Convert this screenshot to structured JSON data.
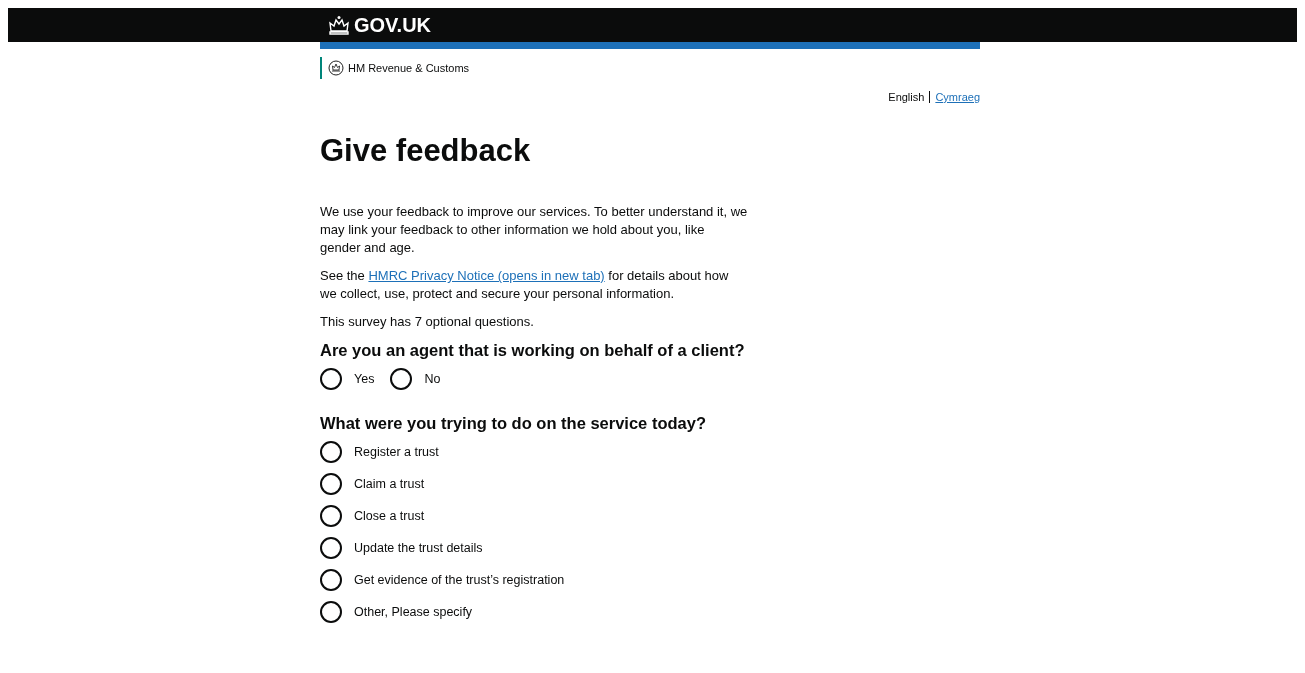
{
  "header": {
    "logo": "GOV.UK"
  },
  "organisation": "HM Revenue & Customs",
  "languages": [
    {
      "label": "English",
      "selected": true
    },
    {
      "label": "Cymraeg",
      "selected": false
    }
  ],
  "title": "Give feedback",
  "intro": "We use your feedback to improve our services. To better understand it, we may link your feedback to other information we hold about you, like gender and age.",
  "privacy": {
    "before": "See the ",
    "link": "HMRC Privacy Notice (opens in new tab)",
    "after": " for details about how we collect, use, protect and secure your personal information."
  },
  "survey_note": "This survey has 7 optional questions.",
  "questions": [
    {
      "text": "Are you an agent that is working on behalf of a client?",
      "kind": "inline",
      "options": [
        {
          "label": "Yes",
          "selected": false
        },
        {
          "label": "No",
          "selected": false
        }
      ]
    },
    {
      "text": "What were you trying to do on the service today?",
      "kind": "stacked",
      "options": [
        {
          "label": "Register a trust",
          "selected": false
        },
        {
          "label": "Claim a trust",
          "selected": false
        },
        {
          "label": "Close a trust",
          "selected": false
        },
        {
          "label": "Update the trust details",
          "selected": false
        },
        {
          "label": "Get evidence of the trust’s registration",
          "selected": false
        },
        {
          "label": "Other, Please specify",
          "selected": false
        }
      ]
    }
  ]
}
